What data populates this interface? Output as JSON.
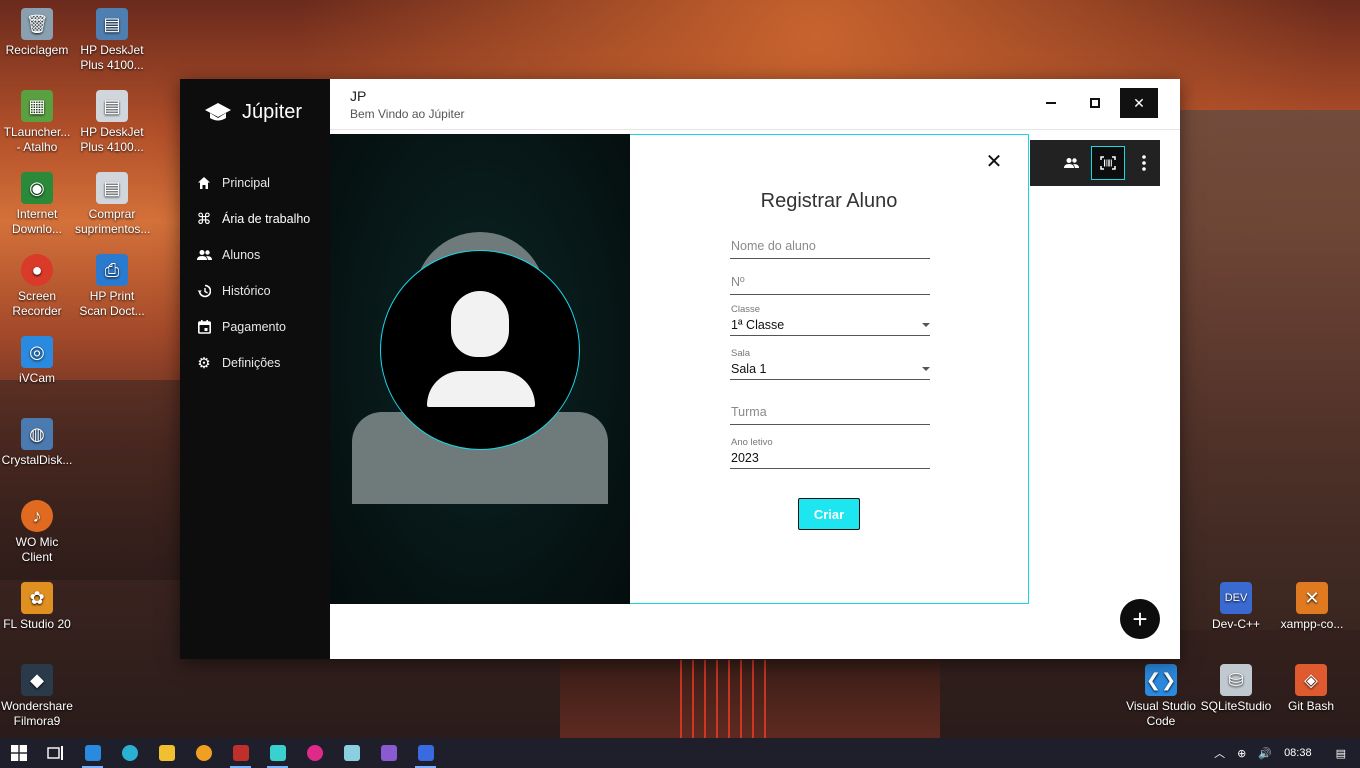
{
  "desktop": {
    "icons": [
      {
        "label": "Reciclagem",
        "color": "#8aa0b0"
      },
      {
        "label": "HP DeskJet Plus 4100...",
        "color": "#4f7fb0"
      },
      {
        "label": "TLauncher... - Atalho",
        "color": "#5aa040"
      },
      {
        "label": "HP DeskJet Plus 4100...",
        "color": "#d0d6dc"
      },
      {
        "label": "Internet Downlo...",
        "color": "#2a8a3a"
      },
      {
        "label": "Comprar suprimentos...",
        "color": "#d0d6dc"
      },
      {
        "label": "Screen Recorder",
        "color": "#d93a2a"
      },
      {
        "label": "HP Print Scan Doct...",
        "color": "#2a7ad0"
      },
      {
        "label": "iVCam",
        "color": "#2a8ae0"
      },
      {
        "label": "CrystalDisk...",
        "color": "#4a7ab0"
      },
      {
        "label": "WO Mic Client",
        "color": "#e06a20"
      },
      {
        "label": "FL Studio 20",
        "color": "#e09020"
      },
      {
        "label": "Wondershare Filmora9",
        "color": "#2a3a4a"
      },
      {
        "label": "Dev-C++",
        "color": "#3a6ad0"
      },
      {
        "label": "xampp-co...",
        "color": "#e07a20"
      },
      {
        "label": "Visual Studio Code",
        "color": "#2a8ae0"
      },
      {
        "label": "SQLiteStudio",
        "color": "#c0c8d0"
      },
      {
        "label": "Git Bash",
        "color": "#e05a30"
      }
    ]
  },
  "taskbar": {
    "items": [
      {
        "name": "start-icon",
        "color": "#ffffff"
      },
      {
        "name": "task-view-icon",
        "color": "#ffffff"
      },
      {
        "name": "vscode-icon",
        "color": "#2a8ae0"
      },
      {
        "name": "edge-icon",
        "color": "#2ab0d0"
      },
      {
        "name": "file-explorer-icon",
        "color": "#f0c030"
      },
      {
        "name": "app-a-icon",
        "color": "#f0a020"
      },
      {
        "name": "access-icon",
        "color": "#c0302a"
      },
      {
        "name": "stack-icon",
        "color": "#3ad0d0"
      },
      {
        "name": "app-pink-icon",
        "color": "#e02a8a"
      },
      {
        "name": "notepad-icon",
        "color": "#8ad0e0"
      },
      {
        "name": "visual-studio-icon",
        "color": "#8a5ad0"
      },
      {
        "name": "app-blue-icon",
        "color": "#3a6ae0"
      }
    ],
    "time": "08:38"
  },
  "app": {
    "brand": "Júpiter",
    "nav": [
      {
        "label": "Principal",
        "icon": "home-icon"
      },
      {
        "label": "Ária de trabalho",
        "icon": "command-icon"
      },
      {
        "label": "Alunos",
        "icon": "people-icon"
      },
      {
        "label": "Histórico",
        "icon": "history-icon"
      },
      {
        "label": "Pagamento",
        "icon": "calendar-icon"
      },
      {
        "label": "Definições",
        "icon": "gear-icon"
      }
    ],
    "header": {
      "title": "JP",
      "subtitle": "Bem Vindo ao  Júpiter"
    },
    "window_buttons": {
      "minimize": "–",
      "maximize": "□",
      "close": "✕"
    },
    "fab": "+"
  },
  "modal": {
    "title": "Registrar Aluno",
    "close": "✕",
    "fields": {
      "nome": {
        "placeholder": "Nome do aluno"
      },
      "numero": {
        "placeholder": "Nº"
      },
      "classe": {
        "label": "Classe",
        "value": "1ª Classe"
      },
      "sala": {
        "label": "Sala",
        "value": "Sala 1"
      },
      "turma": {
        "placeholder": "Turma"
      },
      "ano": {
        "label": "Ano letivo",
        "value": "2023"
      }
    },
    "submit": "Criar"
  }
}
